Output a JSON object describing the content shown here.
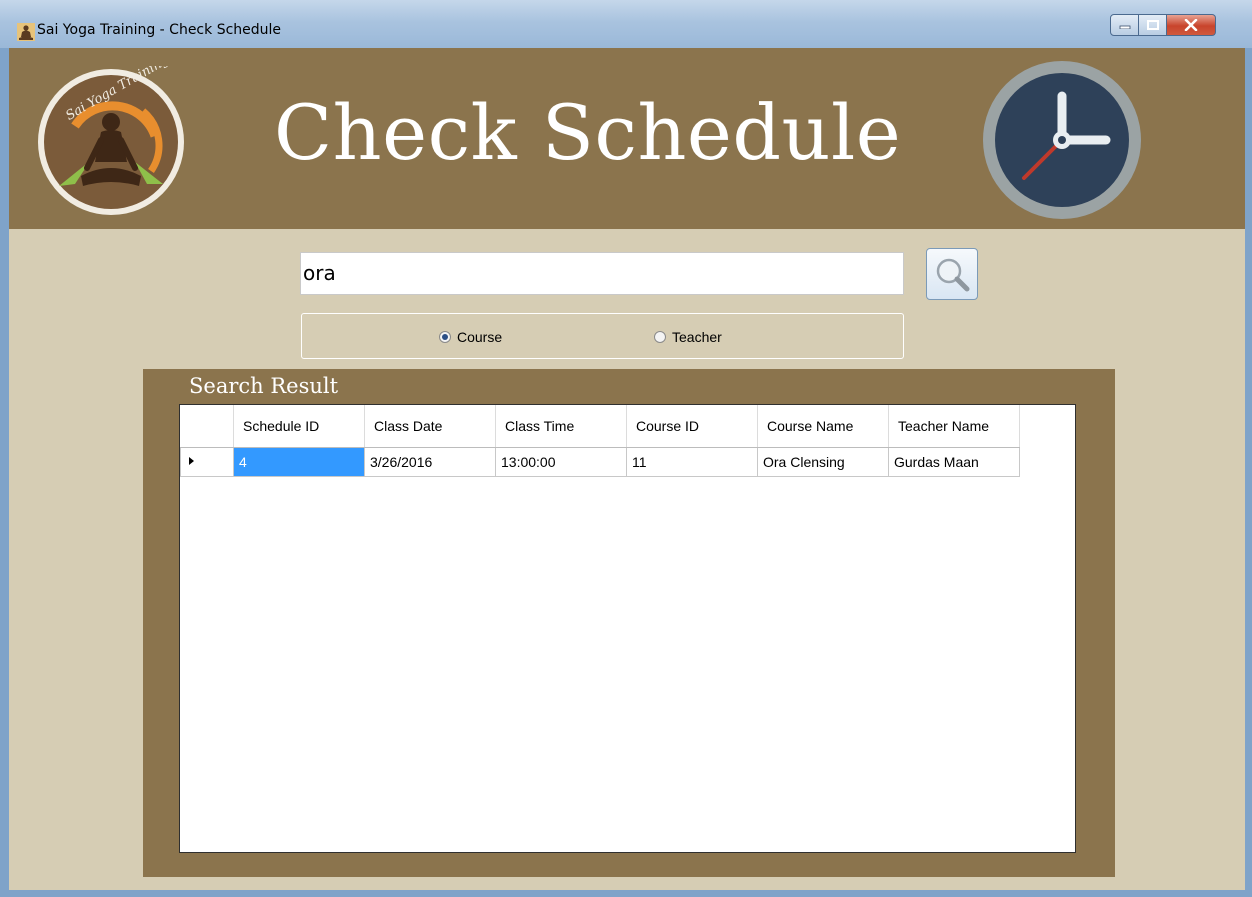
{
  "window": {
    "title": "Sai Yoga Training - Check Schedule"
  },
  "header": {
    "title": "Check Schedule",
    "logo_text": "Sai Yoga Training"
  },
  "search": {
    "value": "ora",
    "button_icon": "magnifier-icon"
  },
  "filter": {
    "options": [
      {
        "label": "Course",
        "selected": true
      },
      {
        "label": "Teacher",
        "selected": false
      }
    ]
  },
  "results": {
    "label": "Search Result",
    "columns": [
      "Schedule ID",
      "Class Date",
      "Class Time",
      "Course ID",
      "Course Name",
      "Teacher Name"
    ],
    "rows": [
      {
        "schedule_id": "4",
        "class_date": "3/26/2016",
        "class_time": "13:00:00",
        "course_id": "11",
        "course_name": "Ora Clensing",
        "teacher_name": "Gurdas Maan"
      }
    ]
  },
  "colors": {
    "header_brown": "#8b744d",
    "client_bg": "#d6cdb4",
    "selection_blue": "#3399ff",
    "clock_face": "#2e4159",
    "clock_hand_red": "#c0392b"
  }
}
